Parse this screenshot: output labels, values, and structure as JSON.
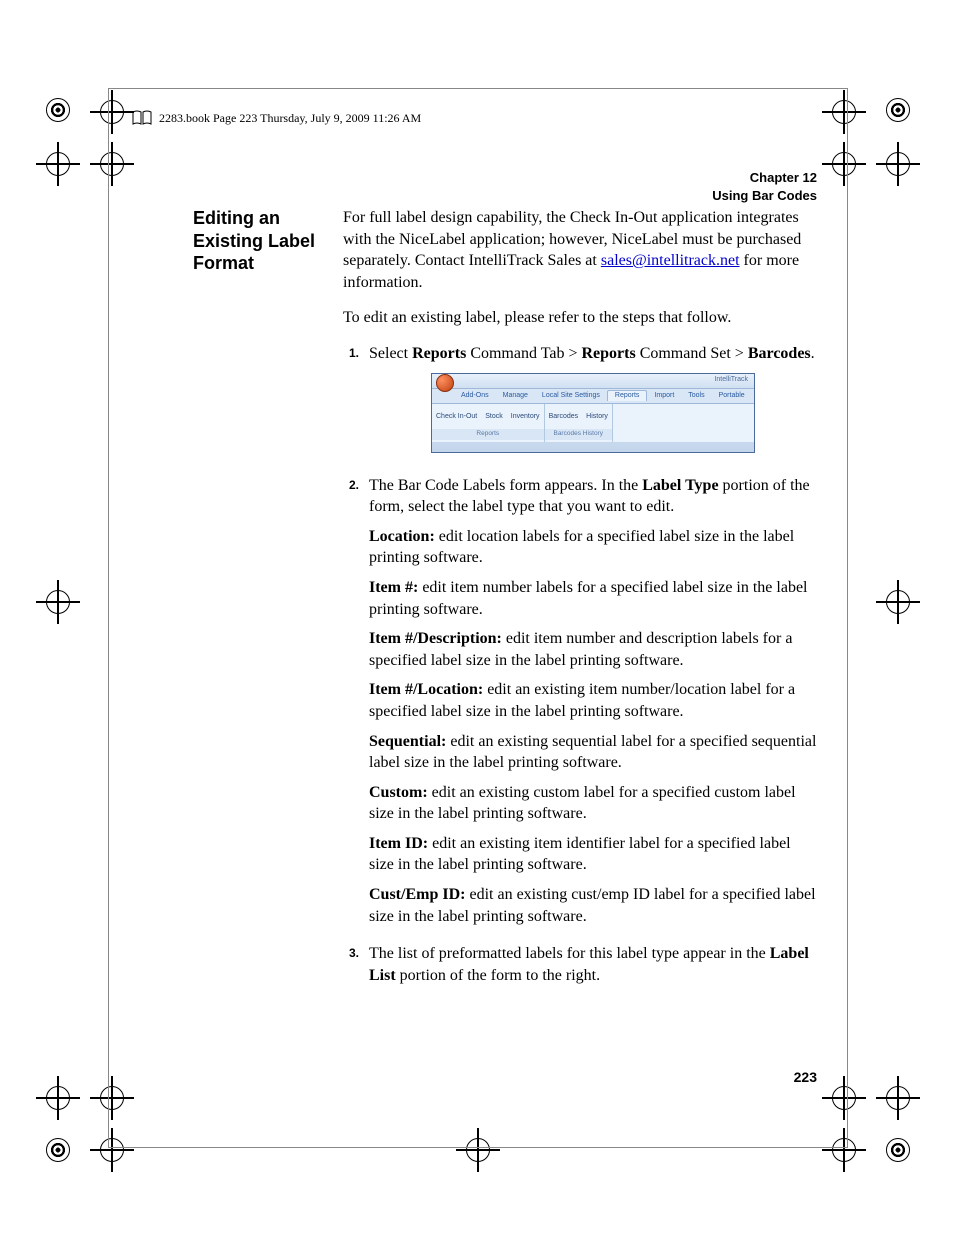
{
  "headerline": "2283.book  Page 223  Thursday, July 9, 2009  11:26 AM",
  "chapter": {
    "line1": "Chapter 12",
    "line2": "Using Bar Codes"
  },
  "section_title": "Editing an Existing Label Format",
  "intro": {
    "pre": "For full label design capability, the Check In-Out application integrates with the NiceLabel application; however, NiceLabel must be purchased separately. Contact IntelliTrack Sales at ",
    "email": "sales@intellitrack.net",
    "post": " for more information."
  },
  "lead": "To edit an existing label, please refer to the steps that follow.",
  "steps": {
    "s1": {
      "num": "1.",
      "pre": "Select ",
      "b1": "Reports",
      "mid1": " Command Tab > ",
      "b2": "Reports",
      "mid2": " Command Set > ",
      "b3": "Barcodes",
      "end": "."
    },
    "s2": {
      "num": "2.",
      "intro_pre": "The Bar Code Labels form appears. In the ",
      "intro_b": "Label Type",
      "intro_post": " portion of the form, select the label type that you want to edit.",
      "items": [
        {
          "label": "Location:",
          "desc": " edit location labels for a specified label size in the label printing software."
        },
        {
          "label": "Item #:",
          "desc": " edit item number labels for a specified label size in the label printing software."
        },
        {
          "label": "Item #/Description:",
          "desc": " edit item number and description labels for a specified label size in the label printing software."
        },
        {
          "label": "Item #/Location:",
          "desc": " edit an existing item number/location label for a specified label size in the label printing software."
        },
        {
          "label": "Sequential:",
          "desc": " edit an existing sequential label for a specified sequential label size in the label printing software."
        },
        {
          "label": "Custom:",
          "desc": " edit an existing custom label for a specified custom label size in the label printing software."
        },
        {
          "label": "Item ID:",
          "desc": " edit an existing item identifier label for a specified label size in the label printing software."
        },
        {
          "label": "Cust/Emp ID:",
          "desc": " edit an existing cust/emp ID label for a specified label size in the label printing software."
        }
      ]
    },
    "s3": {
      "num": "3.",
      "pre": "The list of preformatted labels for this label type appear in the ",
      "b": "Label List",
      "post": " portion of the form to the right."
    }
  },
  "ribbon": {
    "title": "IntelliTrack",
    "tabs": [
      "Add-Ons",
      "Manage",
      "Local Site Settings",
      "Reports",
      "Import",
      "Tools",
      "Portable"
    ],
    "group1": {
      "items": [
        "Check In-Out",
        "Stock",
        "Inventory"
      ],
      "label": "Reports"
    },
    "group2": {
      "items": [
        "Barcodes",
        "History"
      ],
      "label": "Barcodes  History"
    }
  },
  "pagenum": "223"
}
